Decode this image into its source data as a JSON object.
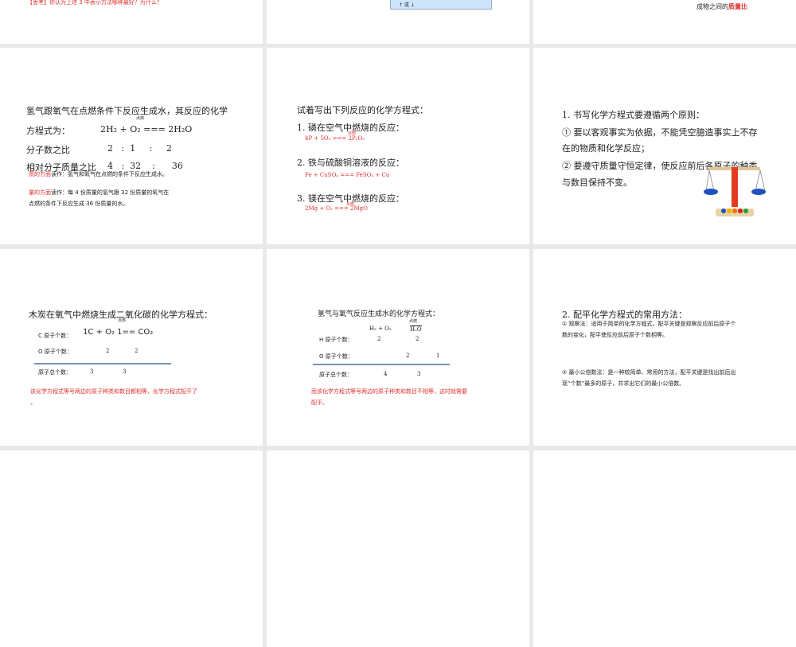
{
  "slides": {
    "s0a": {
      "think": "【思考】你认为上述 3 中表示方法哪种最好？为什么？"
    },
    "s0b": {
      "box": "↑ 或 ↓"
    },
    "s0c": {
      "prefix": "成物之间的",
      "highlight": "质量比"
    },
    "s1": {
      "line1": "氢气跟氧气在点燃条件下反应生成水，其反应的化学",
      "cond": "点燃",
      "line2_label": "方程式为：",
      "eq": "2H₂ + O₂ ===  2H₂O",
      "ratio_label": "分子数之比",
      "ratio": "2   :  1     :     2",
      "mass_label": "相对分子质量之比",
      "mass": "4   :  32    :      36",
      "qual_red": "质的方面",
      "qual": "读作：氢气和氧气在点燃的条件下反应生成水。",
      "quan_red": "量的方面",
      "quan1": "读作：每 4 份质量的氢气跟 32 份质量的氧气在",
      "quan2": "点燃的条件下反应生成 36 份质量的水。"
    },
    "s2": {
      "title": "试着写出下列反应的化学方程式：",
      "q1": "1. 磷在空气中燃烧的反应：",
      "a1": "4P  +  5O₂  ===   2P₂O₅",
      "c1": "点燃",
      "q2": "2. 铁与硫酸铜溶液的反应：",
      "a2": "Fe  +  CuSO₄  ===   FeSO₄ + Cu",
      "q3": "3. 镁在空气中燃烧的反应：",
      "a3": "2Mg +  O₂  ===   2MgO",
      "c3": "点燃"
    },
    "s3": {
      "title": "1. 书写化学方程式要遵循两个原则：",
      "p1a": "① 要以客观事实为依据，不能凭空臆造事实上不存",
      "p1b": "在的物质和化学反应；",
      "p2a": "② 要遵守质量守恒定律，使反应前后各原子的种类",
      "p2b": "与数目保持不变。"
    },
    "s4": {
      "title": "木炭在氧气中燃烧生成二氧化碳的化学方程式：",
      "cond": "点燃",
      "c_label": "C 原子个数：",
      "eq": "1C + O₂  1==  CO₂",
      "o_label": "O 原子个数：",
      "o1": "2",
      "o2": "2",
      "t_label": "原子总个数：",
      "t1": "3",
      "t2": "3",
      "note1": "该化学方程式等号两边的原子种类和数目都相等，化学方程式配平了",
      "note2": "。"
    },
    "s5": {
      "title": "氢气与氧气反应生成水的化学方程式：",
      "cond": "点燃",
      "left": "H₂ + O₂",
      "right": "H₂O",
      "h_label": "H 原子个数：",
      "h1": "2",
      "h2": "2",
      "o_label": "O 原子个数：",
      "o1": "2",
      "o2": "1",
      "t_label": "原子总个数：",
      "t1": "4",
      "t2": "3",
      "note1": "而该化学方程式等号两边的原子种类和数目不相等，这时就需要",
      "note2": "配平。"
    },
    "s6": {
      "title": "2. 配平化学方程式的常用方法：",
      "m1a": "① 观察法：适用于简单的化学方程式，配平关键是观察反应前后原子个",
      "m1b": "数的变化，配平使反应前后原子个数相等。",
      "m2a": "② 最小公倍数法：是一种较简单、常用的方法，配平关键是找出前后出",
      "m2b": "现“个数”最多的原子，并求出它们的最小公倍数。"
    }
  }
}
